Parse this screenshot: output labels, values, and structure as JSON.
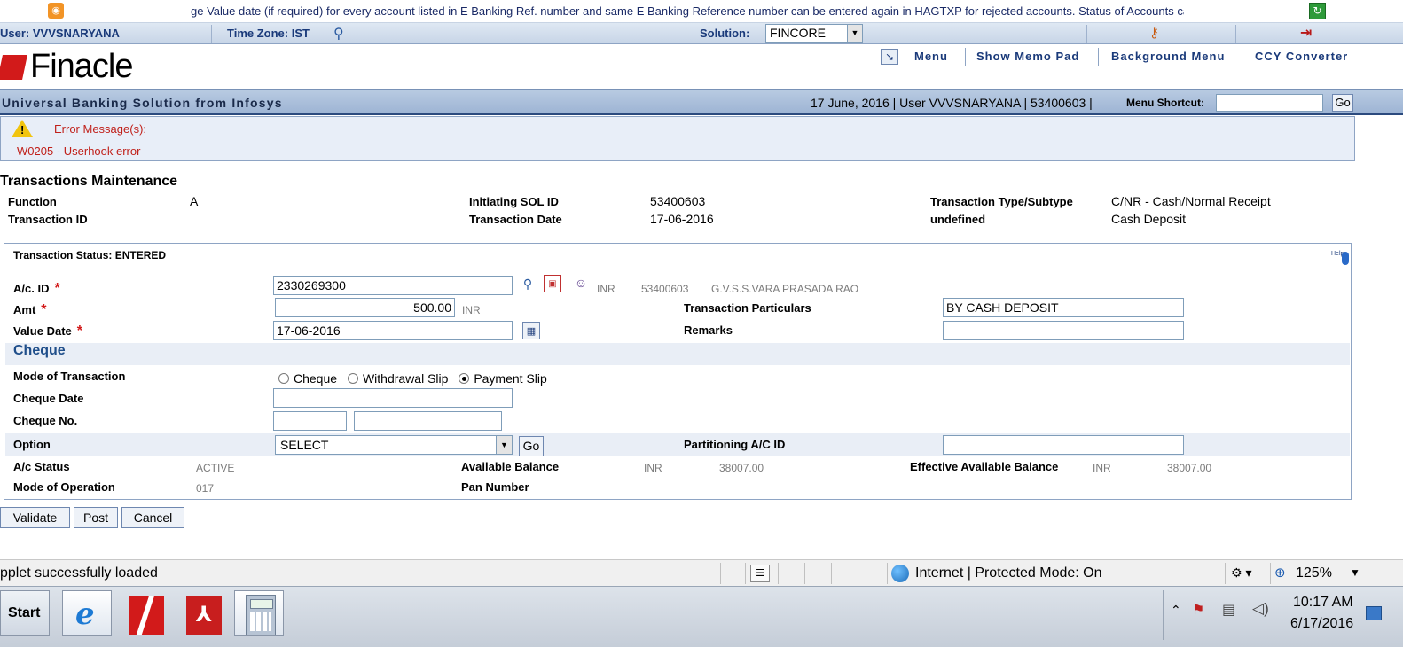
{
  "ticker": {
    "text": "ge Value date (if required) for every account listed in E Banking Ref. number and same E Banking Reference number can be entered again in HAGTXP for rejected accounts. Status of Accounts ca"
  },
  "userbar": {
    "user": "User: VVVSNARYANA",
    "timezone": "Time Zone:  IST",
    "solution_label": "Solution:",
    "solution_value": "FINCORE"
  },
  "header": {
    "logo": "Finacle",
    "menu_items": [
      "Menu",
      "Show Memo Pad",
      "Background Menu",
      "CCY Converter"
    ],
    "tagline": "Universal Banking Solution from Infosys",
    "info": "17 June, 2016 |  User  VVVSNARYANA  |  53400603  |",
    "shortcut_label": "Menu Shortcut:",
    "shortcut_value": "",
    "go_label": "Go"
  },
  "error": {
    "title": "Error Message(s):",
    "message": "W0205 - Userhook error"
  },
  "txn": {
    "title": "Transactions Maintenance",
    "function_label": "Function",
    "function_value": "A",
    "txn_id_label": "Transaction ID",
    "sol_label": "Initiating SOL ID",
    "sol_value": "53400603",
    "date_label": "Transaction Date",
    "date_value": "17-06-2016",
    "type_label": "Transaction Type/Subtype",
    "type_value": "C/NR - Cash/Normal Receipt",
    "undefined_label": "undefined",
    "undefined_value": "Cash Deposit"
  },
  "panel": {
    "status": "Transaction Status: ENTERED",
    "help": "Help",
    "acid_label": "A/c. ID",
    "acid_value": "2330269300",
    "acid_ccy": "INR",
    "acid_sol": "53400603",
    "acid_name": "G.V.S.S.VARA PRASADA RAO",
    "amt_label": "Amt",
    "amt_value": "500.00",
    "amt_ccy": "INR",
    "particulars_label": "Transaction Particulars",
    "particulars_value": "BY CASH DEPOSIT",
    "value_date_label": "Value Date",
    "value_date_value": "17-06-2016",
    "remarks_label": "Remarks",
    "remarks_value": "",
    "cheque_section": "Cheque",
    "mode_label": "Mode of Transaction",
    "mode_options": [
      "Cheque",
      "Withdrawal Slip",
      "Payment Slip"
    ],
    "mode_selected": "Payment Slip",
    "cheque_date_label": "Cheque Date",
    "cheque_no_label": "Cheque No.",
    "option_label": "Option",
    "option_value": "SELECT",
    "option_go": "Go",
    "partition_label": "Partitioning A/C ID",
    "ac_status_label": "A/c Status",
    "ac_status_value": "ACTIVE",
    "avail_label": "Available Balance",
    "avail_ccy": "INR",
    "avail_value": "38007.00",
    "eff_label": "Effective Available Balance",
    "eff_ccy": "INR",
    "eff_value": "38007.00",
    "mode_op_label": "Mode of Operation",
    "mode_op_value": "017",
    "pan_label": "Pan Number"
  },
  "buttons": {
    "validate": "Validate",
    "post": "Post",
    "cancel": "Cancel"
  },
  "browser": {
    "status": "pplet successfully loaded",
    "zone": "Internet | Protected Mode: On",
    "zoom": "125%"
  },
  "taskbar": {
    "start": "Start",
    "time": "10:17 AM",
    "date": "6/17/2016"
  },
  "colors": {
    "brand_red": "#d21a1a",
    "link_blue": "#1a3a7a",
    "error_red": "#c0201a"
  }
}
